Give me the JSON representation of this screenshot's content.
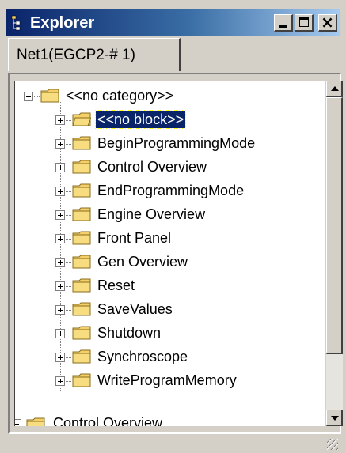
{
  "window": {
    "title": "Explorer",
    "title_icon": "explorer-tree-icon",
    "controls": [
      {
        "name": "minimize",
        "icon": "minimize-icon"
      },
      {
        "name": "maximize",
        "icon": "maximize-icon"
      },
      {
        "name": "close",
        "icon": "close-icon",
        "label": "×"
      }
    ]
  },
  "tabs": [
    {
      "label": "Net1(EGCP2-# 1)",
      "active": true
    }
  ],
  "tree": {
    "root": {
      "label": "<<no category>>",
      "expanded": true
    },
    "children": [
      {
        "label": "<<no block>>",
        "selected": true
      },
      {
        "label": "BeginProgrammingMode"
      },
      {
        "label": "Control Overview"
      },
      {
        "label": "EndProgrammingMode"
      },
      {
        "label": "Engine Overview"
      },
      {
        "label": "Front Panel"
      },
      {
        "label": "Gen Overview"
      },
      {
        "label": "Reset"
      },
      {
        "label": "SaveValues"
      },
      {
        "label": "Shutdown"
      },
      {
        "label": "Synchroscope"
      },
      {
        "label": "WriteProgramMemory"
      }
    ],
    "next_root": {
      "label": "Control Overview",
      "partially_visible": true
    }
  },
  "colors": {
    "title_gradient_start": "#0a246a",
    "title_gradient_end": "#a6caf0",
    "selection": "#0a246a",
    "folder": "#f4d06a"
  }
}
